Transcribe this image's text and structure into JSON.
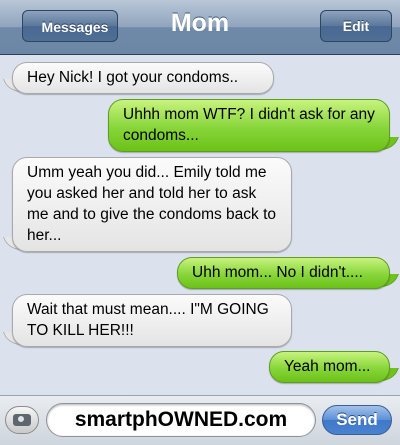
{
  "header": {
    "back_label": "Messages",
    "title": "Mom",
    "edit_label": "Edit"
  },
  "messages": [
    {
      "side": "received",
      "text": "Hey Nick! I got your condoms.."
    },
    {
      "side": "sent",
      "text": "Uhhh mom WTF? I didn't ask for any condoms..."
    },
    {
      "side": "received",
      "text": "Umm yeah you did... Emily told me you asked her and told her to ask me and to give the condoms back to her..."
    },
    {
      "side": "sent",
      "text": "Uhh mom... No I didn't...."
    },
    {
      "side": "received",
      "text": "Wait that must mean.... I\"M GOING TO KILL HER!!!"
    },
    {
      "side": "sent",
      "text": "Yeah mom..."
    }
  ],
  "compose": {
    "value": "smartphOWNED.com",
    "send_label": "Send"
  },
  "colors": {
    "sent_bubble": "#7fd030",
    "received_bubble": "#e8e8e8",
    "navbar": "#6f89a8",
    "send_button": "#4a82d0"
  }
}
